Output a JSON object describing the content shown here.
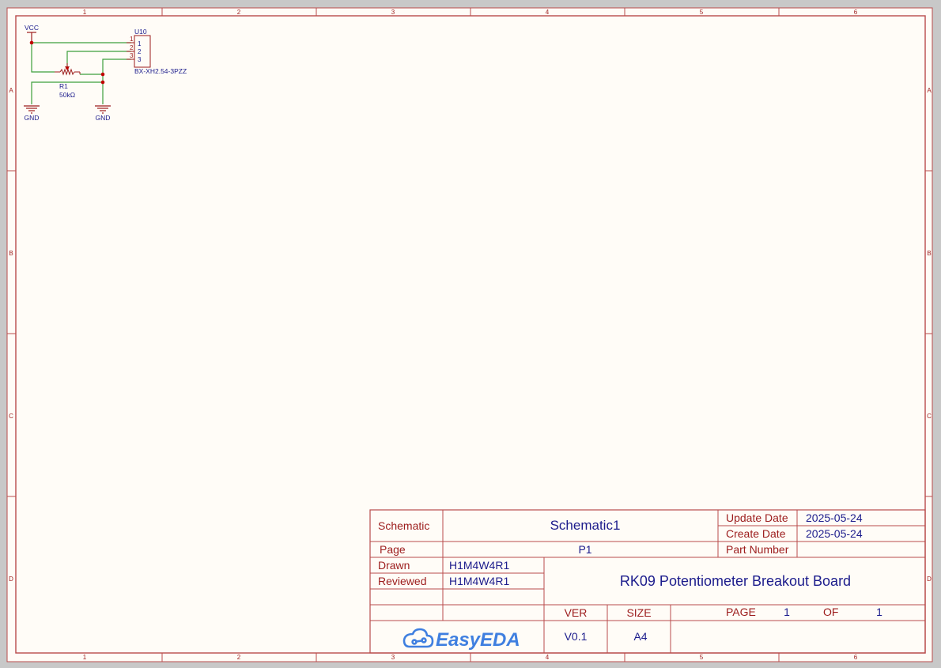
{
  "border": {
    "columns": [
      "1",
      "2",
      "3",
      "4",
      "5",
      "6"
    ],
    "rows": [
      "A",
      "B",
      "C",
      "D"
    ]
  },
  "schematic": {
    "vcc_label": "VCC",
    "gnd_left_label": "GND",
    "gnd_right_label": "GND",
    "connector": {
      "designator": "U10",
      "part": "BX-XH2.54-3PZZ",
      "pins": [
        "1",
        "2",
        "3"
      ],
      "pin_numbers_outside": [
        "1",
        "2",
        "3"
      ]
    },
    "resistor": {
      "designator": "R1",
      "value": "50kΩ"
    }
  },
  "title_block": {
    "schematic_label": "Schematic",
    "schematic_name": "Schematic1",
    "page_label": "Page",
    "page_value": "P1",
    "update_date_label": "Update Date",
    "update_date": "2025-05-24",
    "create_date_label": "Create Date",
    "create_date": "2025-05-24",
    "part_number_label": "Part Number",
    "part_number": "",
    "drawn_label": "Drawn",
    "drawn_by": "H1M4W4R1",
    "reviewed_label": "Reviewed",
    "reviewed_by": "H1M4W4R1",
    "project_title": "RK09 Potentiometer Breakout Board",
    "ver_label": "VER",
    "ver_value": "V0.1",
    "size_label": "SIZE",
    "size_value": "A4",
    "page_num_label": "PAGE",
    "page_num": "1",
    "of_label": "OF",
    "page_total": "1",
    "logo_text": "EasyEDA"
  },
  "colors": {
    "background": "#fffcf7",
    "border": "#b84c4c",
    "wire": "#3ca03c",
    "component": "#9c1c1c",
    "net_label": "#1c1c8c",
    "logo": "#3f7fe0"
  }
}
